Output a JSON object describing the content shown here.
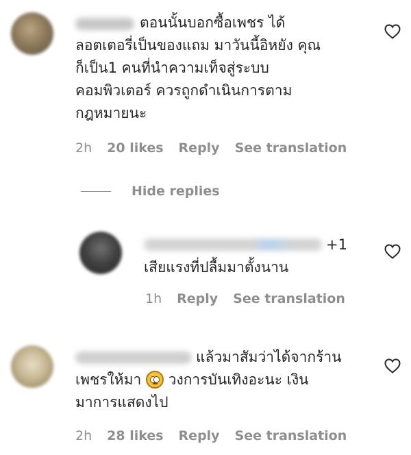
{
  "comments": [
    {
      "text": "ตอนนั้นบอกซื้อเพชร ได้ ลอตเตอรี่เป็นของแถม มาวันนี้อิหยัง คุณ ก็เป็น1 คนที่นำความเท็จสู่ระบบ คอมพิวเตอร์ ควรถูกดำเนินการตาม กฎหมายนะ",
      "lines": [
        "ตอนนั้นบอกซื้อเพชร ได้",
        "ลอตเตอรี่เป็นของแถม มาวันนี้อิหยัง คุณ",
        "ก็เป็น1 คนที่นำความเท็จสู่ระบบ",
        "คอมพิวเตอร์ ควรถูกดำเนินการตาม",
        "กฎหมายนะ"
      ],
      "time": "2h",
      "likes": "20 likes",
      "reply": "Reply",
      "translate": "See translation"
    },
    {
      "lines": [
        "แล้วมาสัมว่าได้จากร้าน",
        "เพชรให้มา",
        "วงการบันเทิงอะนะ เงิน",
        "มาการแสดงไป"
      ],
      "time": "2h",
      "likes": "28 likes",
      "reply": "Reply",
      "translate": "See translation"
    }
  ],
  "hide_replies": "Hide replies",
  "reply_comment": {
    "plus": "+1",
    "text": "เสียแรงที่ปลื้มมาตั้งนาน",
    "time": "1h",
    "reply": "Reply",
    "translate": "See translation"
  },
  "icons": {
    "like": "heart-outline-icon",
    "emoji": "face-with-rolling-eyes-emoji"
  },
  "colors": {
    "text": "#262626",
    "secondary": "#8e8e8e",
    "background": "#ffffff"
  }
}
